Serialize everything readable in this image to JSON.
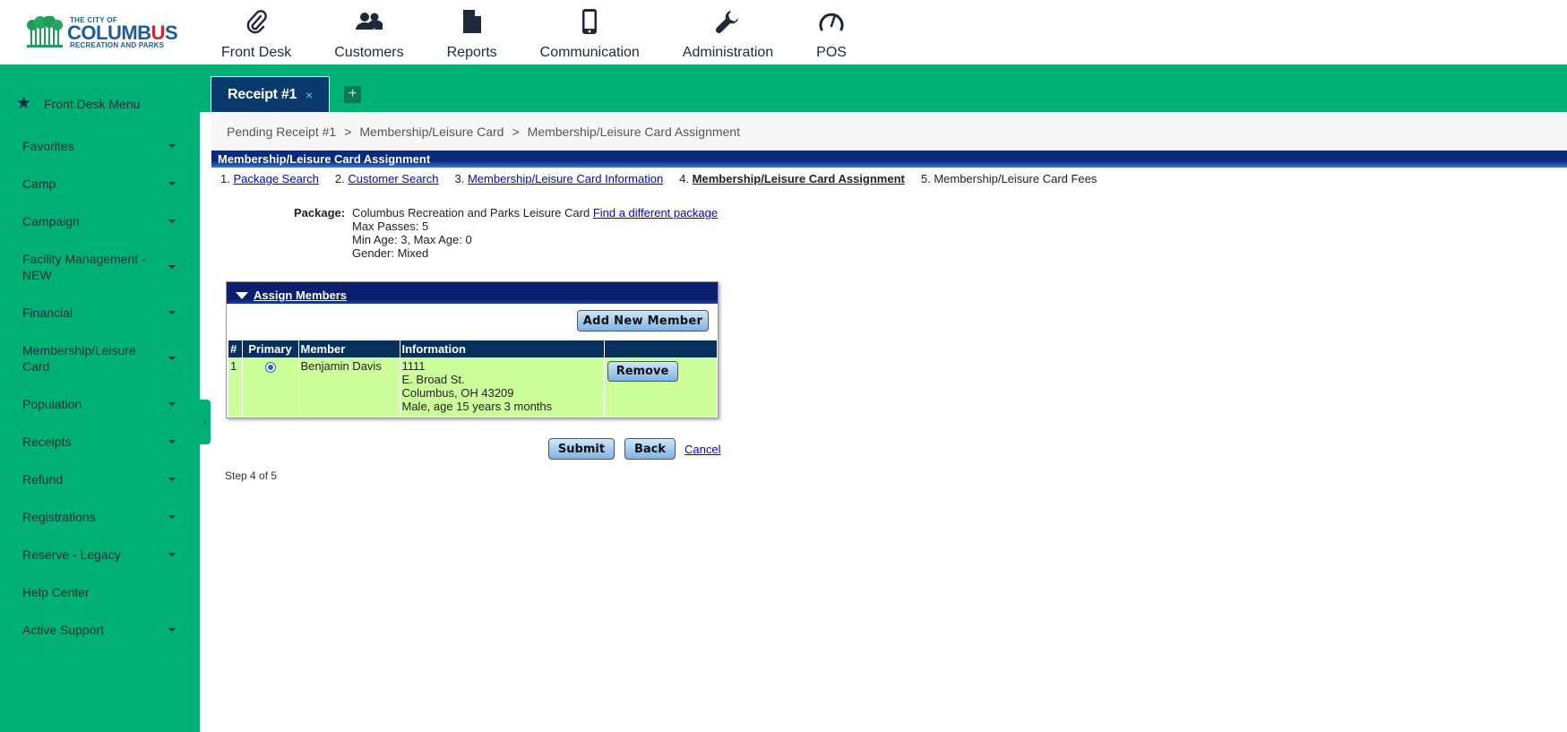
{
  "logo": {
    "line1": "THE CITY OF",
    "line2a": "COLUMB",
    "line2b": "U",
    "line2c": "S",
    "line3": "RECREATION AND PARKS"
  },
  "topnav": [
    {
      "label": "Front Desk",
      "icon": "paperclip-icon"
    },
    {
      "label": "Customers",
      "icon": "users-icon"
    },
    {
      "label": "Reports",
      "icon": "document-icon"
    },
    {
      "label": "Communication",
      "icon": "phone-icon"
    },
    {
      "label": "Administration",
      "icon": "wrench-icon"
    },
    {
      "label": "POS",
      "icon": "gauge-icon"
    }
  ],
  "sidebar": {
    "menu_title": "Front Desk Menu",
    "items": [
      {
        "label": "Favorites"
      },
      {
        "label": "Camp"
      },
      {
        "label": "Campaign"
      },
      {
        "label": "Facility Management - NEW"
      },
      {
        "label": "Financial"
      },
      {
        "label": "Membership/Leisure Card"
      },
      {
        "label": "Population"
      },
      {
        "label": "Receipts"
      },
      {
        "label": "Refund"
      },
      {
        "label": "Registrations"
      },
      {
        "label": "Reserve - Legacy"
      },
      {
        "label": "Help Center"
      },
      {
        "label": "Active Support"
      }
    ]
  },
  "tabs": {
    "active_label": "Receipt #1",
    "close_glyph": "×",
    "add_glyph": "+"
  },
  "breadcrumb": {
    "items": [
      "Pending Receipt #1",
      "Membership/Leisure Card",
      "Membership/Leisure Card Assignment"
    ],
    "separator": ">"
  },
  "section_title": "Membership/Leisure Card Assignment",
  "steps": [
    {
      "num": "1.",
      "label": "Package Search"
    },
    {
      "num": "2.",
      "label": "Customer Search"
    },
    {
      "num": "3.",
      "label": "Membership/Leisure Card Information"
    },
    {
      "num": "4.",
      "label": "Membership/Leisure Card Assignment"
    },
    {
      "num": "5.",
      "label": "Membership/Leisure Card Fees"
    }
  ],
  "package": {
    "label": "Package:",
    "name": "Columbus Recreation and Parks Leisure Card",
    "change_link": "Find a different package",
    "max_passes": "Max Passes: 5",
    "ages": "Min Age: 3, Max Age: 0",
    "gender": "Gender: Mixed"
  },
  "assign": {
    "title": "Assign Members",
    "add_button": "Add New Member",
    "columns": [
      "#",
      "Primary",
      "Member",
      "Information",
      ""
    ],
    "rows": [
      {
        "index": "1",
        "primary_selected": true,
        "member": "Benjamin Davis",
        "info_line1": "1111",
        "info_line2": "E. Broad St.",
        "info_line3": "Columbus, OH 43209",
        "info_line4": "Male, age 15 years 3 months",
        "remove_label": "Remove"
      }
    ]
  },
  "actions": {
    "submit": "Submit",
    "back": "Back",
    "cancel": "Cancel"
  },
  "step_of": "Step 4 of 5",
  "colors": {
    "brand_green": "#00b074",
    "navy": "#08305c",
    "row_green": "#ccff99"
  }
}
